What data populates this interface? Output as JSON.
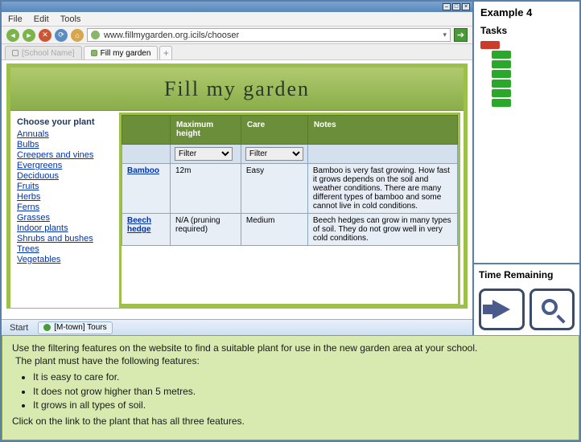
{
  "menu": {
    "file": "File",
    "edit": "Edit",
    "tools": "Tools"
  },
  "url": "www.fillmygarden.org.icils/chooser",
  "tabs": {
    "school": "[School Name]",
    "active": "Fill my garden"
  },
  "page_title": "Fill my garden",
  "sidebar": {
    "heading": "Choose your plant",
    "items": [
      "Annuals",
      "Bulbs",
      "Creepers and vines",
      "Evergreens",
      "Deciduous",
      "Fruits",
      "Herbs",
      "Ferns",
      "Grasses",
      "Indoor plants",
      "Shrubs and bushes",
      "Trees",
      "Vegetables"
    ]
  },
  "table": {
    "headers": {
      "name": "",
      "height": "Maximum height",
      "care": "Care",
      "notes": "Notes"
    },
    "filter_label": "Filter",
    "rows": [
      {
        "name": "Bamboo",
        "height": "12m",
        "care": "Easy",
        "notes": "Bamboo is very fast growing. How fast it grows depends on the soil and weather conditions. There are many different types of bamboo and some cannot live in cold conditions."
      },
      {
        "name": "Beech hedge",
        "height": "N/A (pruning required)",
        "care": "Medium",
        "notes": "Beech hedges can grow in many types of soil. They do not grow well in very cold conditions."
      }
    ]
  },
  "taskbar": {
    "start": "Start",
    "app": "[M-town] Tours"
  },
  "right": {
    "title": "Example 4",
    "tasks_label": "Tasks",
    "task_colors": [
      "red",
      "green",
      "green",
      "green",
      "green",
      "green",
      "green"
    ],
    "time_label": "Time Remaining"
  },
  "instructions": {
    "line1": "Use the filtering features on the website to find a suitable plant for use in the new garden area at your school.",
    "line2": "The plant must have the following features:",
    "bullets": [
      "It is easy to care for.",
      "It does not grow higher than 5 metres.",
      "It grows in all types of soil."
    ],
    "line3": "Click on the link to the plant that has all three features."
  }
}
